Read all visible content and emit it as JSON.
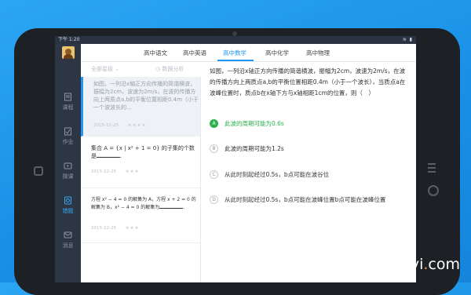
{
  "statusbar": {
    "time": "下午 1:20",
    "icons": "≋ ▮"
  },
  "sidebar": {
    "items": [
      {
        "label": "课程",
        "icon": "course-icon"
      },
      {
        "label": "作业",
        "icon": "homework-icon"
      },
      {
        "label": "微课",
        "icon": "video-icon"
      },
      {
        "label": "错题",
        "icon": "mistake-icon"
      },
      {
        "label": "消息",
        "icon": "message-icon"
      }
    ],
    "active_index": 3
  },
  "tabs": [
    "高中语文",
    "高中英语",
    "高中数学",
    "高中化学",
    "高中物理"
  ],
  "active_tab_index": 2,
  "filter": {
    "grade": "全部星级 ⌄",
    "analysis": "◷ 数据分析"
  },
  "list": [
    {
      "text": "如图，一列沿x轴正方向传播的简谐横波，振幅为2cm，波速为2m/s，在波的传播方向上两质点a,b的平衡位置相距0.4m（小于一个波波长的...",
      "date": "2015-12-25",
      "stars": "★★★★"
    },
    {
      "text_a": "集合 A = {x | x² + 1 = 0} 的子集的个数是",
      "text_b": ".",
      "date": "2015-12-25",
      "stars": "★★★"
    },
    {
      "text_a": "方程 x² − 4 = 0 的解集为 A，方程 x + 2 = 0 的解集为 B，x² − 4 = 0 的解集为",
      "text_b": ".",
      "date": "2015-12-25",
      "stars": "★★★"
    }
  ],
  "question": {
    "body": "如图，一列沿x轴正方向传播的简谐横波，振幅为2cm，波速为2m/s，在波的传播方向上两质点a,b的平衡位置相距0.4m（小于一个波长），当质点a在波峰位置时，质点b在x轴下方与x轴相距1cm的位置，则（　）",
    "options": [
      {
        "letter": "A",
        "text": "此波的周期可能为0.6s",
        "correct": true
      },
      {
        "letter": "B",
        "text": "此波的周期可能为1.2s",
        "correct": false
      },
      {
        "letter": "C",
        "text": "从此时刻起经过0.5s，b点可能在波谷位",
        "correct": false
      },
      {
        "letter": "D",
        "text": "从此时刻起经过0.5s，b点可能在波峰位置b点可能在波峰位置",
        "correct": false
      }
    ]
  },
  "watermark": {
    "main": "Downyi",
    "dot": ".",
    "tld": "com"
  },
  "colors": {
    "accent": "#2196f3",
    "correct": "#2bb24c",
    "sidebar": "#2d3645",
    "background": "#1990e6"
  }
}
